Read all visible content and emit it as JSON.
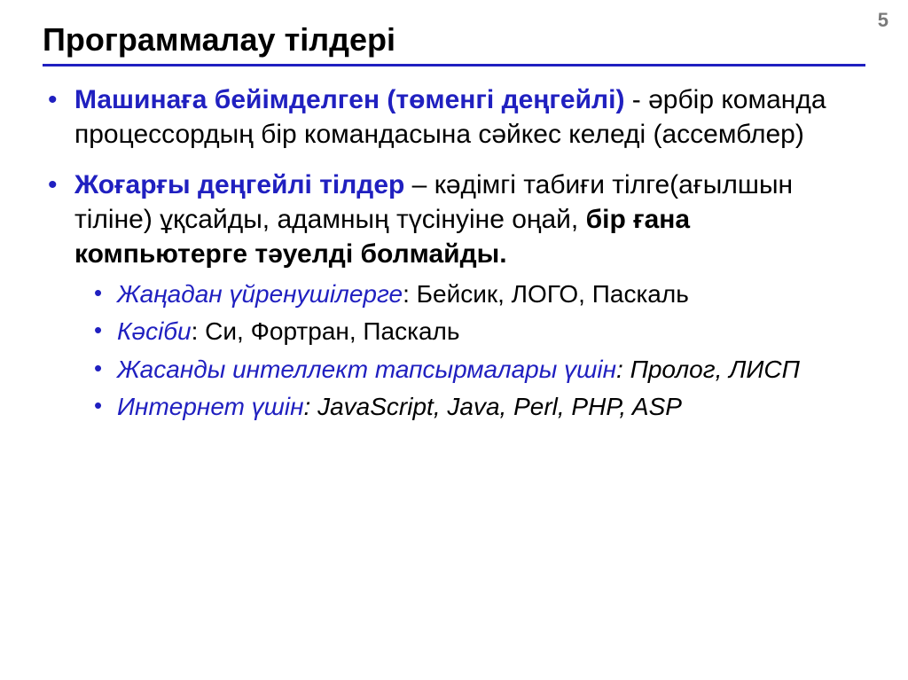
{
  "pageNumber": "5",
  "title": "Программалау тілдері",
  "b1_lead": "Машинаға бейімделген (төменгі деңгейлі)",
  "b1_rest": " - әрбір команда процессордың бір командасына сәйкес келеді (ассемблер)",
  "b2_lead": "Жоғарғы деңгейлі тілдер",
  "b2_mid": " – кәдімгі табиғи тілге(ағылшын тіліне) ұқсайды, адамның түсінуіне оңай, ",
  "b2_bold": "бір ғана компьютерге тәуелді болмайды.",
  "s1_lead": "Жаңадан үйренушілерге",
  "s1_rest": ": Бейсик, ЛОГО, Паскаль",
  "s2_lead": "Кәсіби",
  "s2_rest": ": Си, Фортран, Паскаль",
  "s3_lead": "Жасанды интеллект тапсырмалары үшін",
  "s3_rest": ": Пролог, ЛИСП",
  "s4_lead": "Интернет үшін",
  "s4_rest": ": JavaScript, Java, Perl, PHP, ASP"
}
